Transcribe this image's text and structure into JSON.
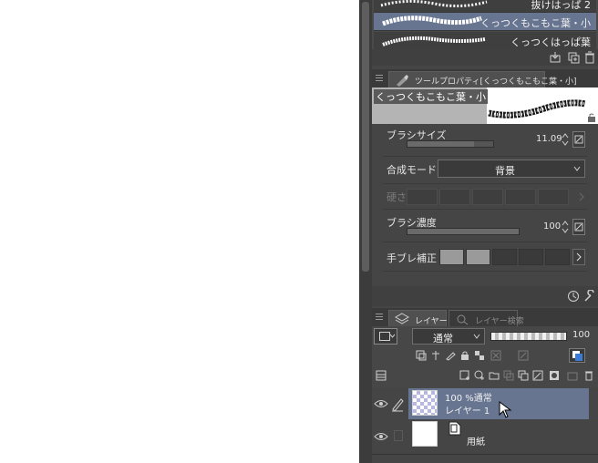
{
  "brush_list": {
    "items": [
      {
        "label": "抜けはっぱ 2",
        "selected": false
      },
      {
        "label": "くっつくもこもこ葉・小",
        "selected": true
      },
      {
        "label": "くっつくはっぱ葉",
        "selected": false
      }
    ]
  },
  "tool_property": {
    "tab_title": "ツールプロパティ[くっつくもこもこ葉・小]",
    "preview_name": "くっつくもこもこ葉・小",
    "brush_size": {
      "label": "ブラシサイズ",
      "value": "11.09",
      "fraction": 0.78
    },
    "blend_mode": {
      "label": "合成モード",
      "value": "背景"
    },
    "hardness": {
      "label": "硬さ"
    },
    "brush_density": {
      "label": "ブラシ濃度",
      "value": "100",
      "fraction": 1.0
    },
    "stabilization": {
      "label": "手ブレ補正",
      "level": 2,
      "levels": 5
    }
  },
  "layer_panel": {
    "tab_layer": "レイヤー",
    "tab_search": "レイヤー検索",
    "blend_mode": "通常",
    "opacity": "100",
    "layers": [
      {
        "opacity_mode": "100 %通常",
        "name": "レイヤー 1",
        "selected": true
      },
      {
        "opacity_mode": "",
        "name": "用紙",
        "selected": false
      }
    ]
  },
  "colors": {
    "panel_bg": "#454545",
    "selection": "#687591",
    "accent_blue": "#3a7bd5"
  }
}
